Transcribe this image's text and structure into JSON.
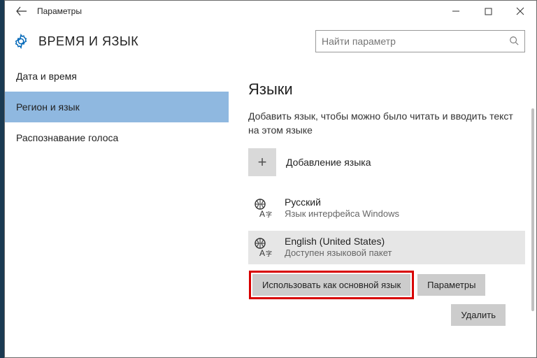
{
  "window": {
    "title": "Параметры"
  },
  "header": {
    "section_title": "ВРЕМЯ И ЯЗЫК",
    "search_placeholder": "Найти параметр"
  },
  "sidebar": {
    "items": [
      {
        "label": "Дата и время",
        "selected": false
      },
      {
        "label": "Регион и язык",
        "selected": true
      },
      {
        "label": "Распознавание голоса",
        "selected": false
      }
    ]
  },
  "content": {
    "page_title": "Языки",
    "description": "Добавить язык, чтобы можно было читать и вводить текст на этом языке",
    "add_label": "Добавление языка",
    "languages": [
      {
        "name": "Русский",
        "sub": "Язык интерфейса Windows",
        "selected": false
      },
      {
        "name": "English (United States)",
        "sub": "Доступен языковой пакет",
        "selected": true
      }
    ],
    "buttons": {
      "set_default": "Использовать как основной язык",
      "options": "Параметры",
      "remove": "Удалить"
    }
  }
}
